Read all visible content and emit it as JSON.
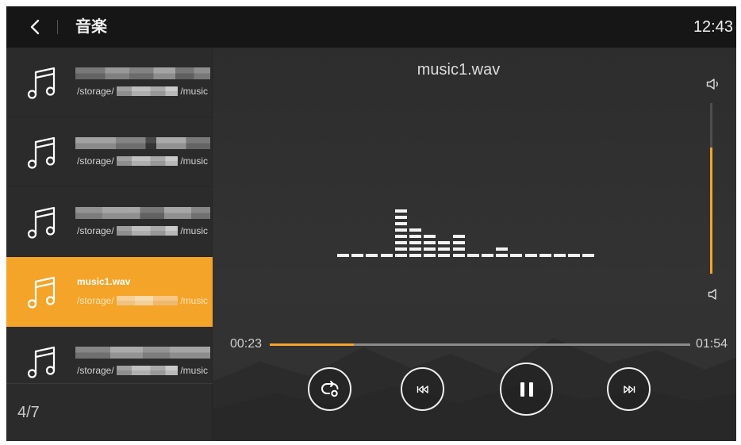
{
  "topbar": {
    "title": "音楽",
    "time": "12:43"
  },
  "playlist": {
    "items": [
      {
        "path_prefix": "/storage/",
        "path_suffix": "/music",
        "active": false
      },
      {
        "path_prefix": "/storage/",
        "path_suffix": "/music",
        "active": false
      },
      {
        "path_prefix": "/storage/",
        "path_suffix": "/music",
        "active": false
      },
      {
        "title": "music1.wav",
        "path_prefix": "/storage/",
        "path_suffix": "/music",
        "active": true
      },
      {
        "path_prefix": "/storage/",
        "path_suffix": "/music",
        "active": false
      }
    ],
    "position": "4/7"
  },
  "player": {
    "track_title": "music1.wav",
    "elapsed": "00:23",
    "duration": "01:54",
    "progress": 0.2,
    "volume_level": 0.74,
    "equalizer_levels": [
      1,
      1,
      1,
      1,
      8,
      5,
      4,
      3,
      4,
      1,
      1,
      2,
      1,
      1,
      1,
      1,
      1,
      1
    ]
  },
  "icons": {
    "back": "chevron-left-icon",
    "track": "music-note-icon",
    "volume_high": "volume-icon",
    "volume_low": "volume-low-icon",
    "repeat": "repeat-icon",
    "previous": "skip-previous-icon",
    "pause": "pause-icon",
    "next": "skip-next-icon"
  },
  "colors": {
    "accent": "#f4a429",
    "topbar_bg": "#161616",
    "sidebar_bg": "#2b2b2b"
  }
}
